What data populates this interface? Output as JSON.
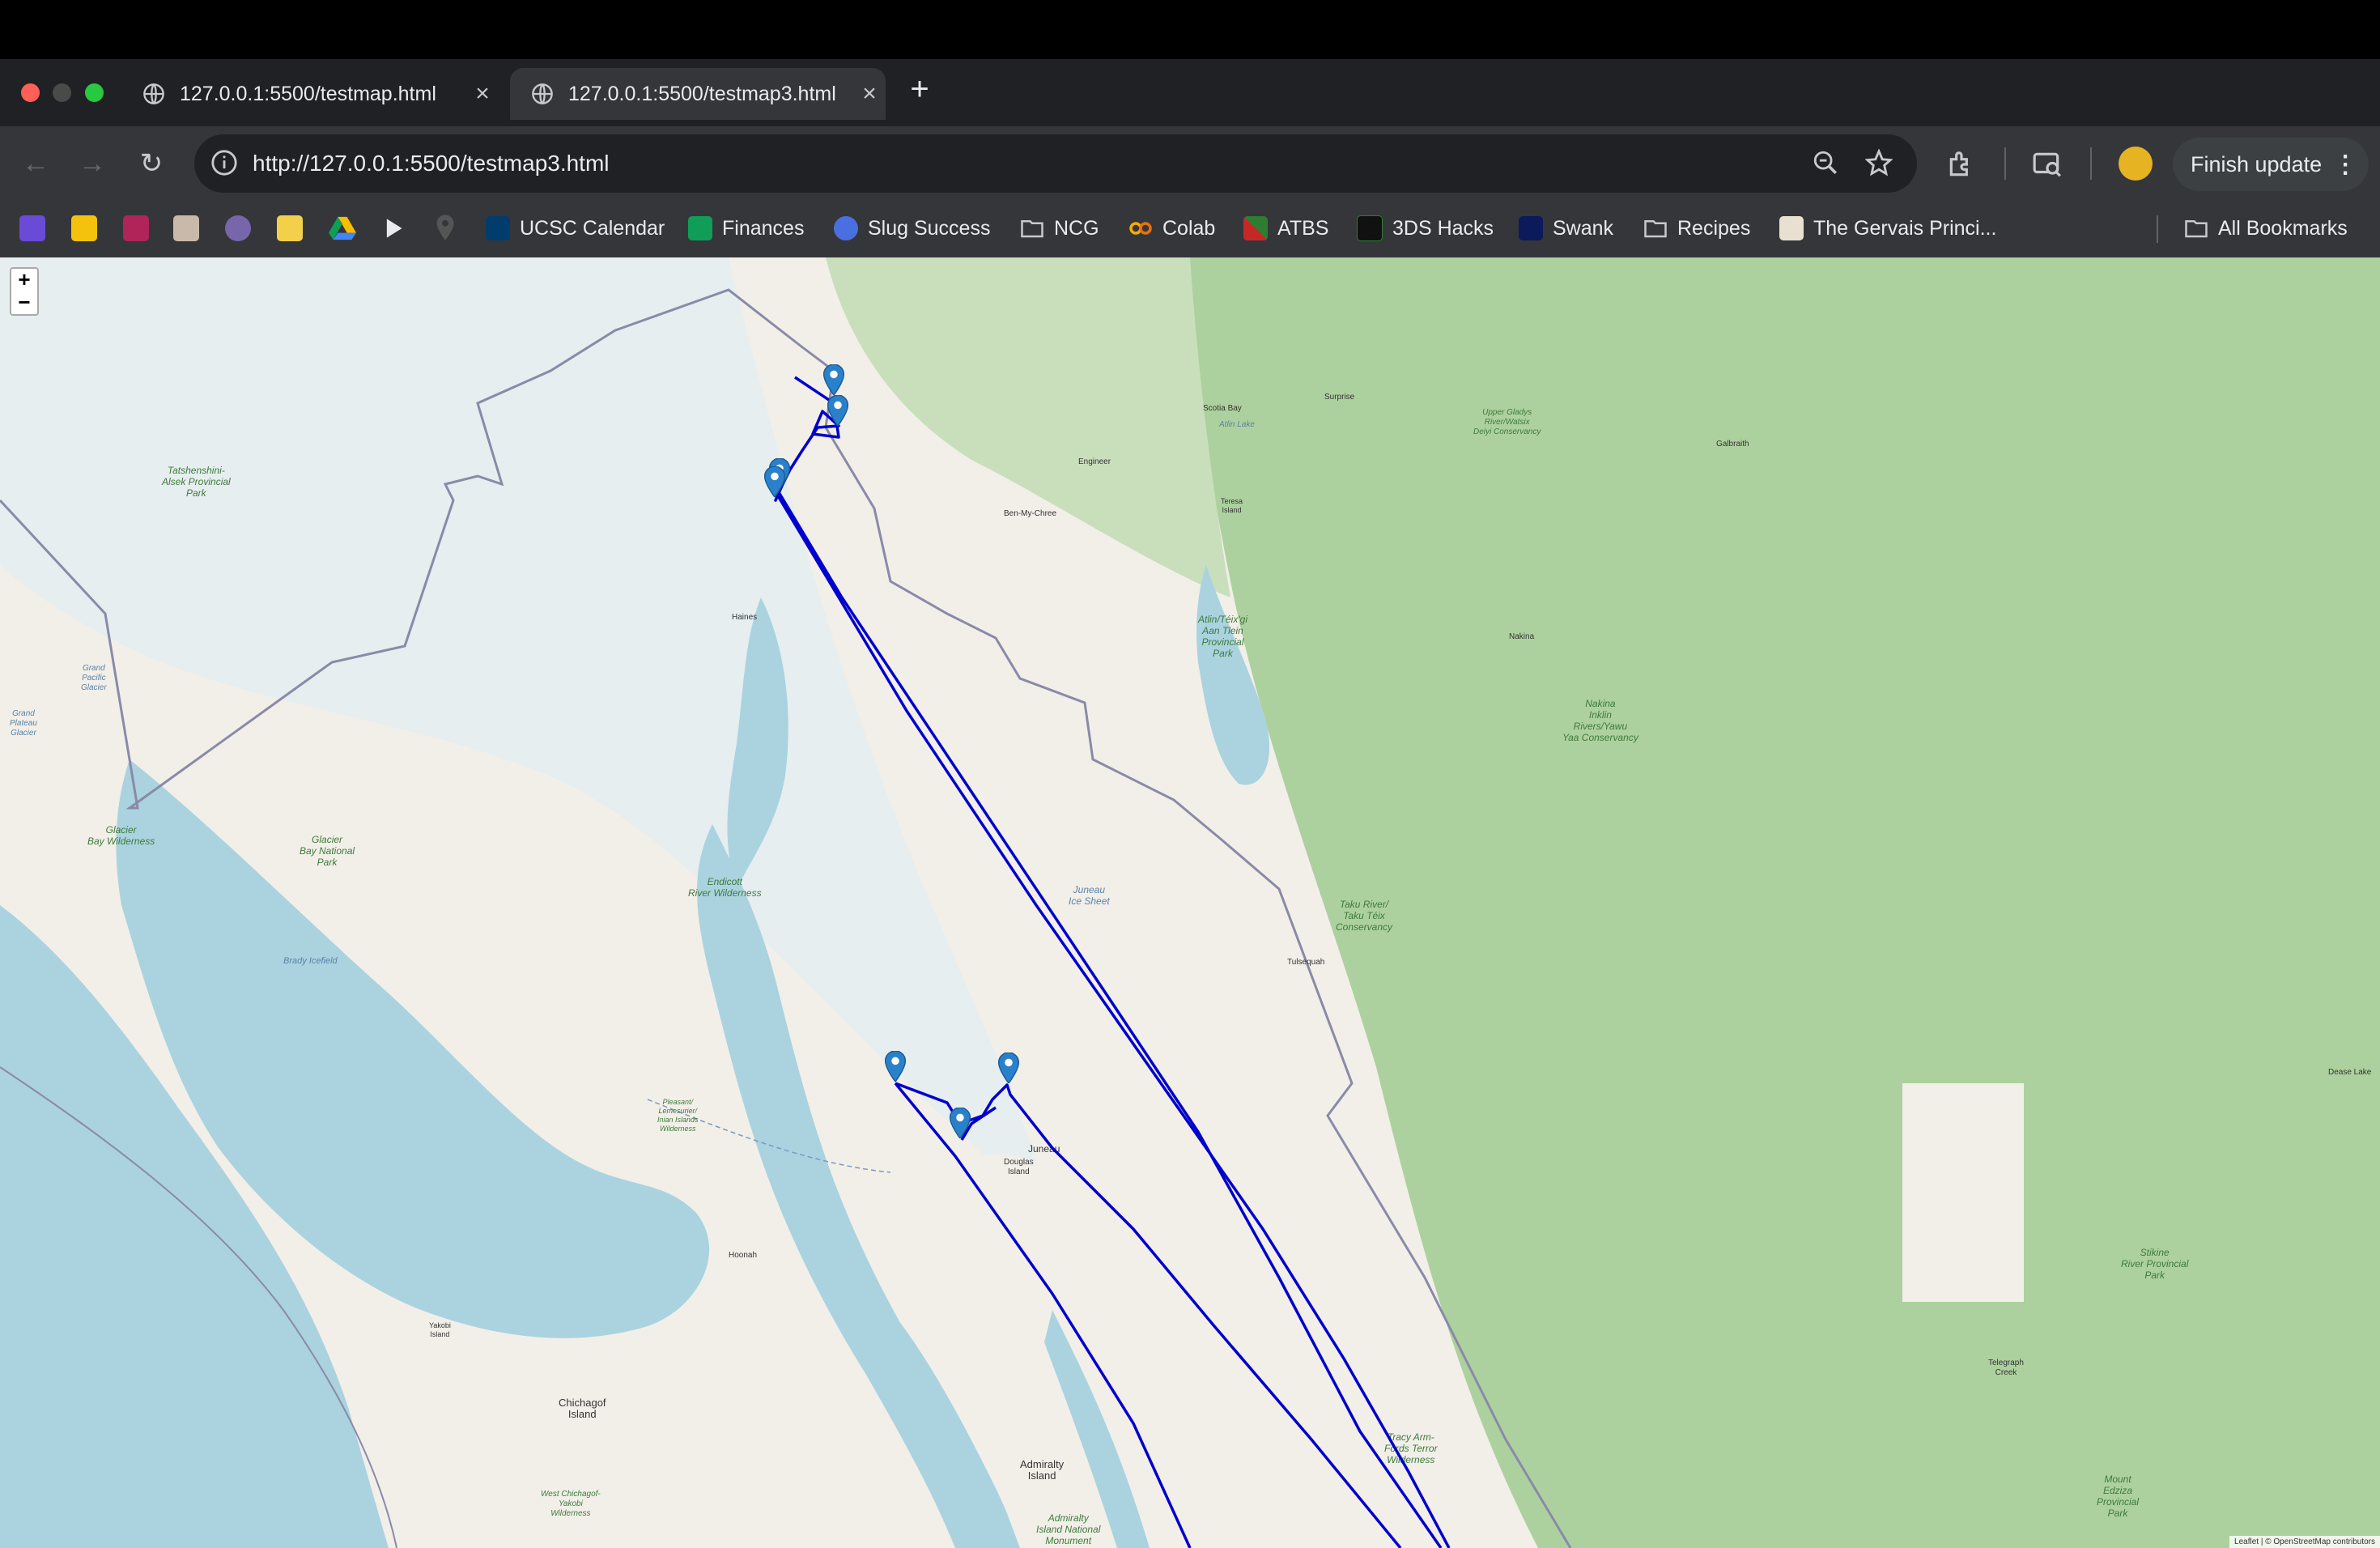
{
  "browser": {
    "tabs": [
      {
        "title": "127.0.0.1:5500/testmap.html",
        "active": false
      },
      {
        "title": "127.0.0.1:5500/testmap3.html",
        "active": true
      }
    ],
    "address": "http://127.0.0.1:5500/testmap3.html",
    "finish_update_label": "Finish update"
  },
  "bookmarks": [
    {
      "label": "UCSC Calendar",
      "icon": "ucsc-icon"
    },
    {
      "label": "Finances",
      "icon": "sheets-icon"
    },
    {
      "label": "Slug Success",
      "icon": "slug-success-icon"
    },
    {
      "label": "NCG",
      "icon": "folder-icon"
    },
    {
      "label": "Colab",
      "icon": "colab-icon"
    },
    {
      "label": "ATBS",
      "icon": "atbs-icon"
    },
    {
      "label": "3DS Hacks",
      "icon": "3ds-icon"
    },
    {
      "label": "Swank",
      "icon": "swank-icon"
    },
    {
      "label": "Recipes",
      "icon": "folder-icon"
    },
    {
      "label": "The Gervais Princi...",
      "icon": "page-icon"
    }
  ],
  "all_bookmarks_label": "All Bookmarks",
  "map": {
    "zoom_in": "+",
    "zoom_out": "−",
    "attribution": "Leaflet | © OpenStreetMap contributors",
    "labels": {
      "tatshenshini": "Tatshenshini-\nAlsek Provincial\nPark",
      "glacier_bay_wild": "Glacier\nBay Wilderness",
      "glacier_bay_np": "Glacier\nBay National\nPark",
      "endicott": "Endicott\nRiver Wilderness",
      "juneau_icefield": "Juneau\nIce Sheet",
      "atlin": "Atlin/Téix'gi\nAan Tlein\nProvincial\nPark",
      "nakina": "Nakina\nInklin\nRivers/Yawu\nYaa Conservancy",
      "taku": "Taku River/\nTaku Téix\nConservancy",
      "stikine": "Stikine\nRiver Provincial\nPark",
      "tracy_arm": "Tracy Arm-\nFords Terror\nWilderness",
      "admiralty": "Admiralty\nIsland",
      "admiralty_nm": "Admiralty\nIsland National\nMonument",
      "chichagof": "Chichagof\nIsland",
      "mount_edziza": "Mount\nEdziza\nProvincial\nPark",
      "juneau": "Juneau",
      "douglas": "Douglas\nIsland",
      "haines": "Haines",
      "hoonah": "Hoonah",
      "atlin_lake": "Atlin Lake",
      "tulsequah": "Tulsequah",
      "telegraph_creek": "Telegraph\nCreek",
      "dease_lake": "Dease Lake",
      "brady_icefield": "Brady Icefield",
      "grand_pacific": "Grand\nPacific\nGlacier",
      "grand_plateau": "Grand\nPlateau\nGlacier",
      "pleasant_lemesurier": "Pleasant/\nLemesurier/\nInian Islands\nWilderness",
      "west_chichagof": "West Chichagof-\nYakobi\nWilderness",
      "yakobi": "Yakobi\nIsland",
      "surprise": "Surprise",
      "galbraith": "Galbraith",
      "nakina_town": "Nakina",
      "engineer": "Engineer",
      "teresa": "Teresa\nIsland",
      "ben_my_chree": "Ben-My-Chree",
      "scotia_bay": "Scotia Bay",
      "upper_gladys": "Upper Gladys\nRiver/Watsix\nDeiyi Conservancy"
    }
  },
  "colors": {
    "route": "#0000cc",
    "marker": "#2a81cb",
    "water": "#aad3df",
    "forest": "#add19e",
    "ice": "#dde9ee",
    "land": "#f2efe9"
  }
}
